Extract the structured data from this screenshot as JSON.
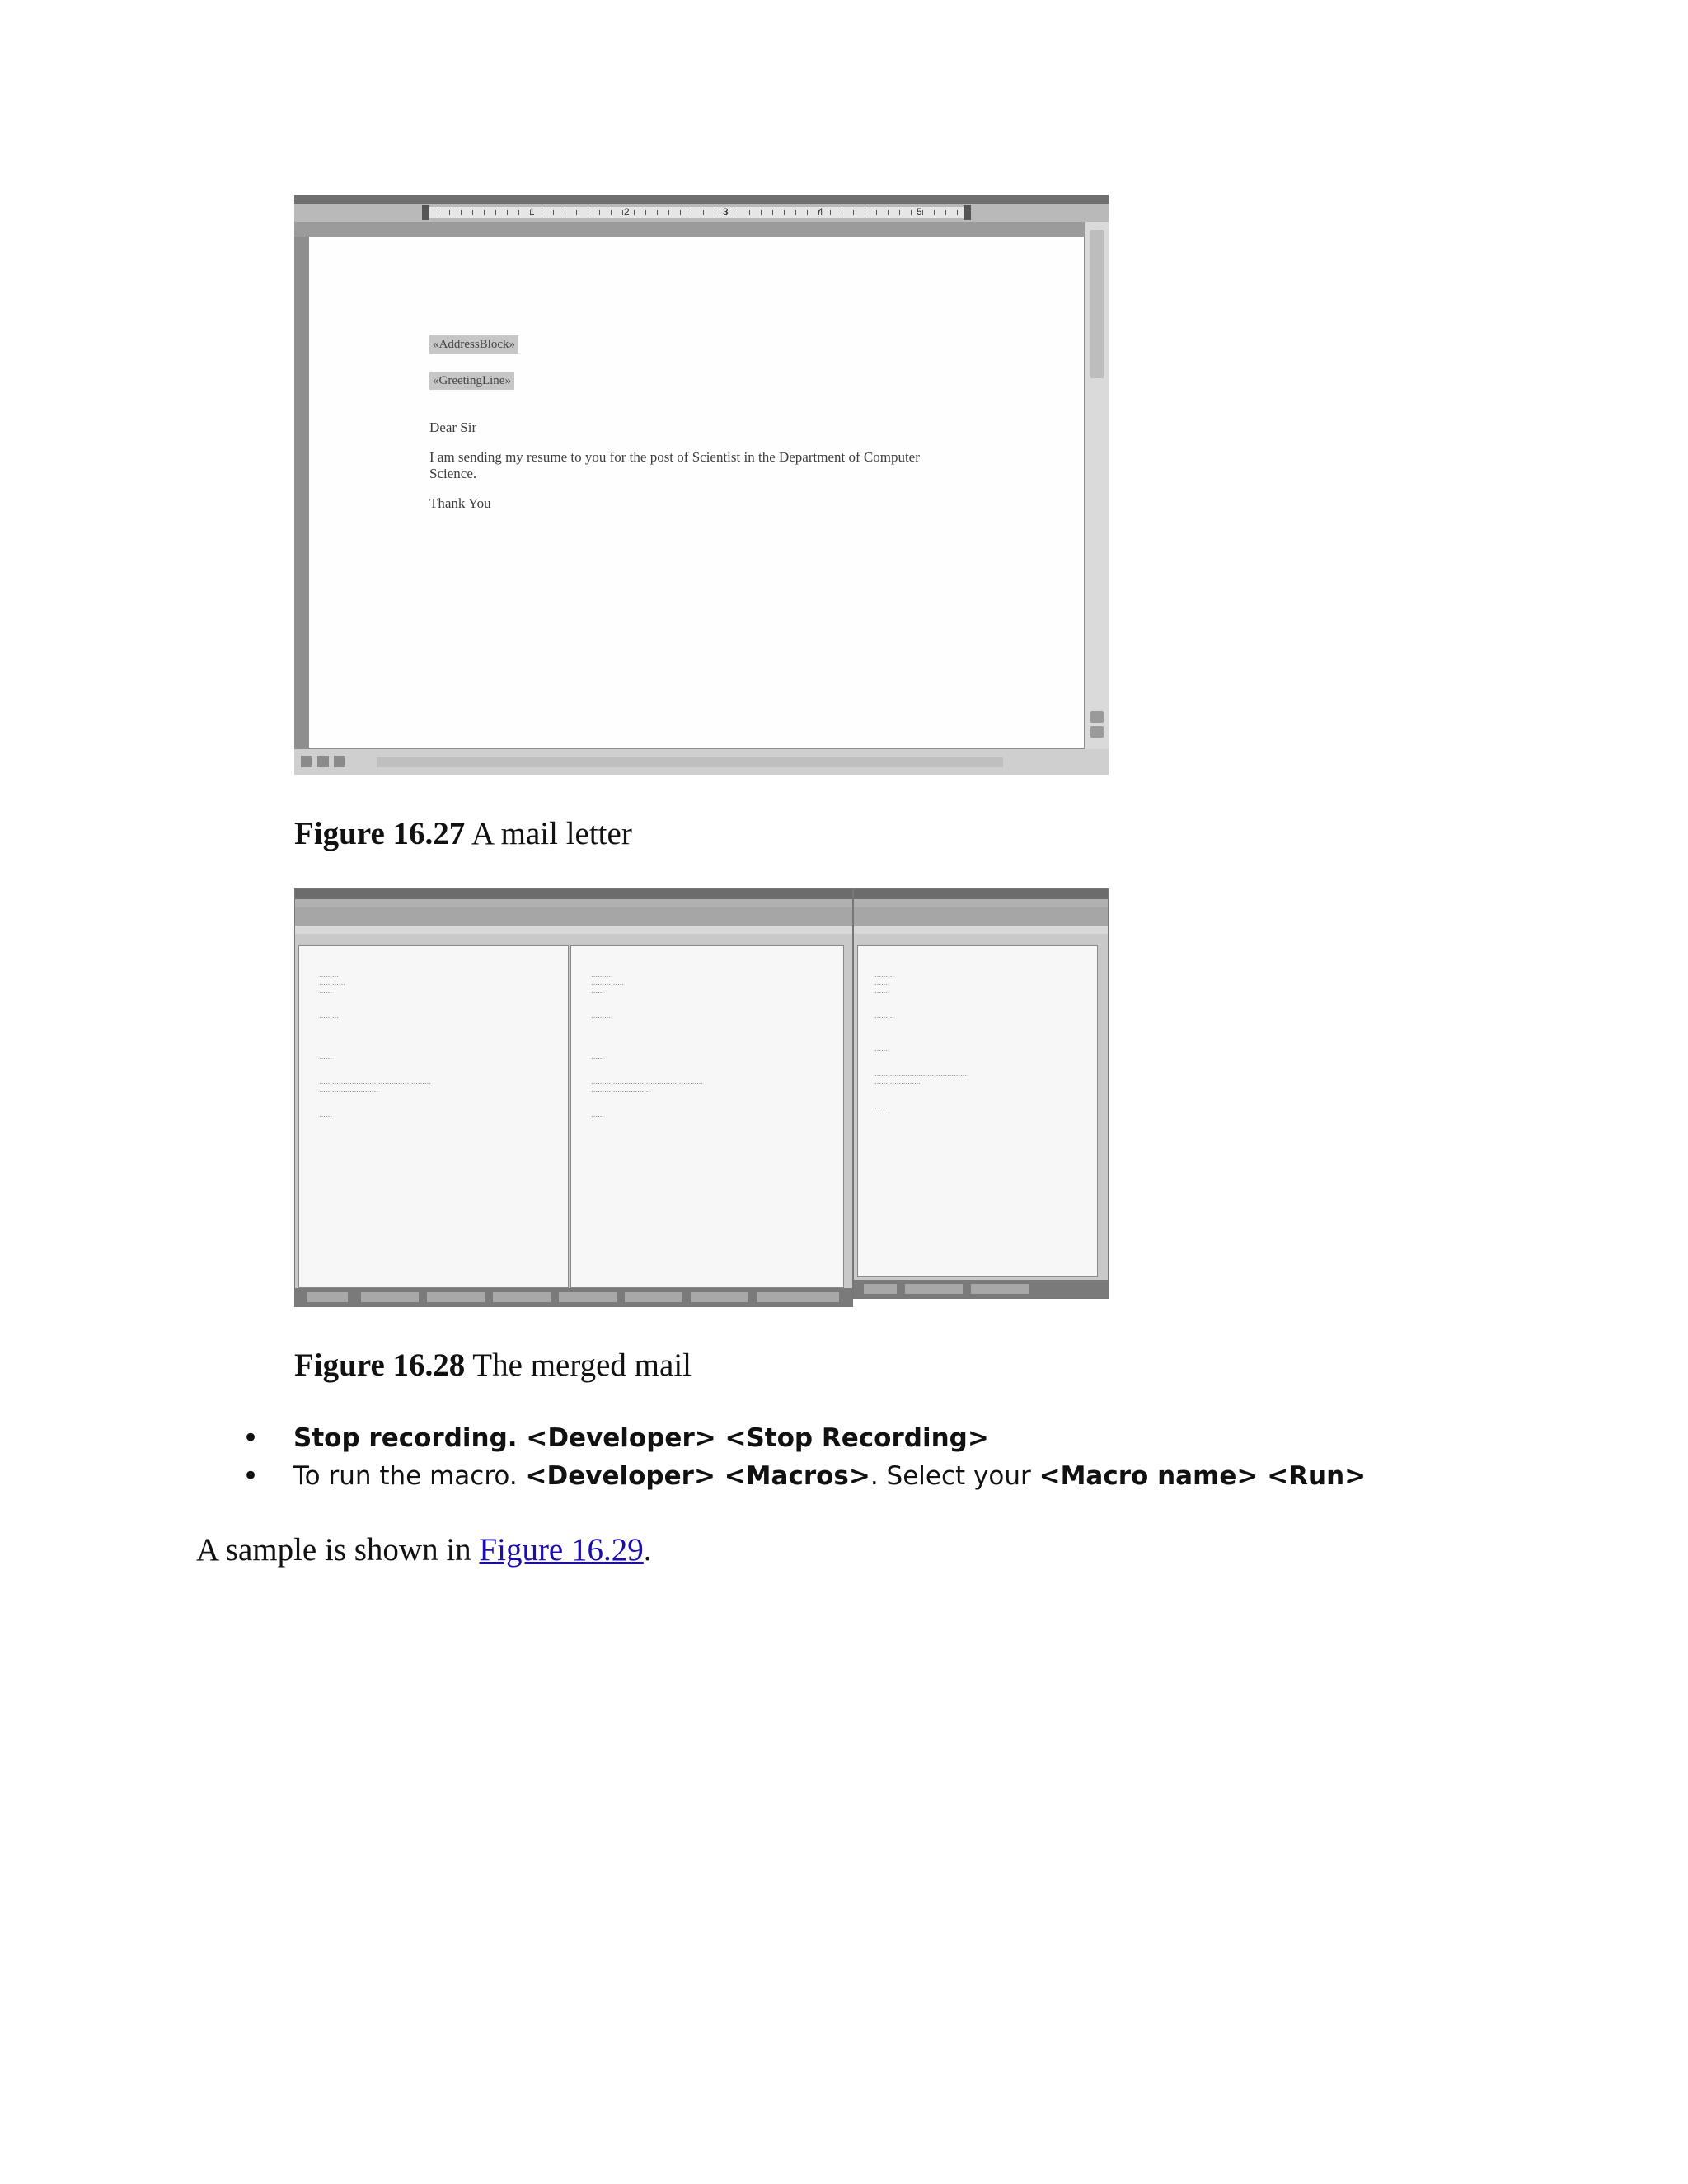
{
  "figure_1": {
    "ruler_numbers": [
      "1",
      "2",
      "3",
      "4",
      "5"
    ],
    "letter": {
      "field_address": "«AddressBlock»",
      "field_greeting": "«GreetingLine»",
      "salutation": "Dear Sir",
      "body_line1": "I am sending my resume to you for the post of Scientist in the Department of Computer",
      "body_line2": "Science.",
      "closing": "Thank You"
    },
    "caption_number": "Figure 16.27",
    "caption_text": " A mail letter"
  },
  "figure_2": {
    "caption_number": "Figure 16.28",
    "caption_text": " The merged mail"
  },
  "bullets": {
    "item1_bold": "Stop recording. <Developer> <Stop Recording>",
    "item2_prefix": "To run the macro. ",
    "item2_bold1": "<Developer> <Macros>",
    "item2_mid": ". Select your ",
    "item2_bold2": "<Macro name> <Run>"
  },
  "paragraph": {
    "prefix": "A sample is shown in ",
    "link": "Figure 16.29",
    "suffix": "."
  }
}
